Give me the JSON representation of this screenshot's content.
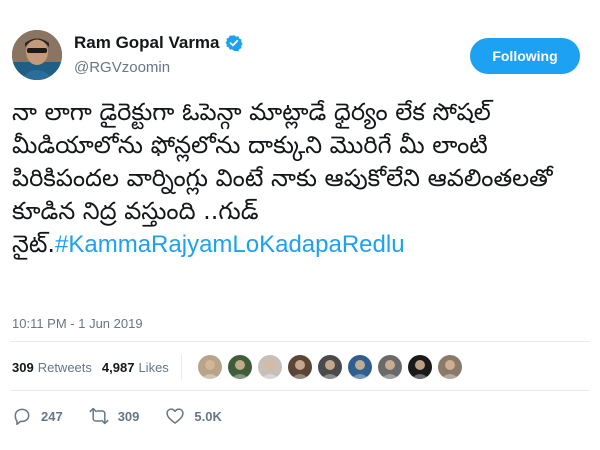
{
  "user": {
    "display_name": "Ram Gopal Varma",
    "handle": "@RGVzoomin",
    "verified": true,
    "avatar_icon": "user-avatar"
  },
  "follow_button": {
    "label": "Following",
    "color": "#1da1f2"
  },
  "tweet": {
    "text": "నా లాగా డైరెక్టుగా ఓపెన్గా మాట్లాడే ధైర్యం లేక సోషల్ మీడియాలోను ఫోన్లలోను దాక్కుని మొరిగే మీ లాంటి పిరికిపందల వార్నింగ్లు వింటే నాకు ఆపుకోలేని ఆవలింతలతో కూడిన నిద్ర వస్తుంది ..గుడ్ నైట్.",
    "hashtag": "#KammaRajyamLoKadapaRedlu",
    "timestamp": "10:11 PM - 1 Jun 2019"
  },
  "stats": {
    "retweets_count": "309",
    "retweets_label": "Retweets",
    "likes_count": "4,987",
    "likes_label": "Likes",
    "liker_avatars": [
      {
        "color": "#b8a48a"
      },
      {
        "color": "#3f5d3a"
      },
      {
        "color": "#c8c0b8"
      },
      {
        "color": "#5a4636"
      },
      {
        "color": "#4a4a4a"
      },
      {
        "color": "#2f5f8f"
      },
      {
        "color": "#6a6a6a"
      },
      {
        "color": "#1a1a1a"
      },
      {
        "color": "#8a7a6a"
      }
    ]
  },
  "actions": {
    "replies": {
      "icon": "reply-icon",
      "count": "247"
    },
    "retweets": {
      "icon": "retweet-icon",
      "count": "309"
    },
    "likes": {
      "icon": "heart-icon",
      "count": "5.0K"
    }
  },
  "colors": {
    "accent": "#1da1f2",
    "muted_text": "#657786",
    "primary_text": "#14171a",
    "divider": "#e6ecf0"
  }
}
